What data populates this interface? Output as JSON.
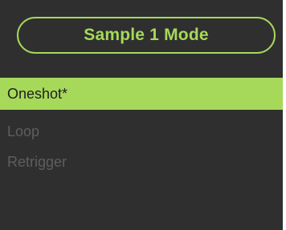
{
  "panel": {
    "title": "Sample 1 Mode",
    "accent_color": "#a6d95a",
    "background_color": "#2f2f2f",
    "options": [
      {
        "label": "Oneshot*",
        "selected": true
      },
      {
        "label": "Loop",
        "selected": false
      },
      {
        "label": "Retrigger",
        "selected": false
      }
    ]
  }
}
